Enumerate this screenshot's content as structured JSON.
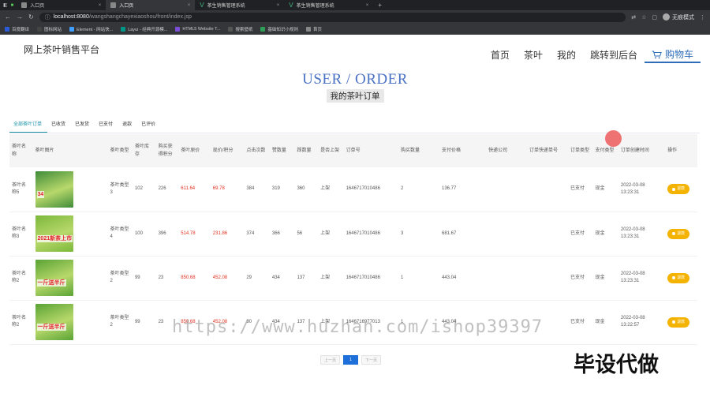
{
  "browser": {
    "tabs": [
      {
        "label": "入口页",
        "active": false,
        "icon": "page-icon"
      },
      {
        "label": "入口页",
        "active": true,
        "icon": "page-icon"
      },
      {
        "label": "茶生销售管理系统",
        "active": false,
        "icon": "vue-icon"
      },
      {
        "label": "茶生销售管理系统",
        "active": false,
        "icon": "vue-icon"
      }
    ],
    "url_host": "localhost:8080",
    "url_path": "/wangshangchayexiaoshou/front/index.jsp",
    "profile_label": "无痕模式",
    "bookmarks": [
      {
        "label": "百度翻译",
        "color": "#2b5bd7"
      },
      {
        "label": "图标网站",
        "color": "#444444"
      },
      {
        "label": "Element - 网站快...",
        "color": "#409eff"
      },
      {
        "label": "Layui - 经典开源模...",
        "color": "#009688"
      },
      {
        "label": "HTML5 Website T...",
        "color": "#7a4fd6"
      },
      {
        "label": "搜索壁纸",
        "color": "#555555"
      },
      {
        "label": "基础知识小规则",
        "color": "#2e9e57"
      },
      {
        "label": "首页",
        "color": "#888888"
      }
    ]
  },
  "header": {
    "brand": "网上茶叶销售平台",
    "nav": [
      "首页",
      "茶叶",
      "我的",
      "跳转到后台",
      "购物车"
    ],
    "title": "USER / ORDER",
    "subtitle": "我的茶叶订单"
  },
  "status_tabs": [
    "全部茶叶订单",
    "已收货",
    "已发货",
    "已支付",
    "退款",
    "已评价"
  ],
  "table": {
    "columns": [
      "茶叶名称",
      "茶叶图片",
      "茶叶类型",
      "茶叶库存",
      "购买获得积分",
      "茶叶原价",
      "现价/积分",
      "点击次数",
      "赞数量",
      "踩数量",
      "是否上架",
      "订单号",
      "购买数量",
      "支付价格",
      "快递公司",
      "订单快递单号",
      "订单类型",
      "支付类型",
      "订单创建时间",
      "操作"
    ],
    "rows": [
      {
        "name": "茶叶名称5",
        "img_color": "#3f8c3a",
        "img_text": "34",
        "type": "茶叶类型3",
        "stock": "102",
        "points": "226",
        "orig": "611.64",
        "price": "69.78",
        "clicks": "384",
        "likes": "319",
        "dislikes": "360",
        "listed": "上架",
        "order_no": "1646717010486",
        "qty": "2",
        "paid": "136.77",
        "courier": "",
        "tracking": "",
        "order_type": "已支付",
        "pay_type": "现金",
        "created": "2022-03-08 13:23:31",
        "action": "退款"
      },
      {
        "name": "茶叶名称3",
        "img_color": "#7bb83b",
        "img_text": "2021新茶上市",
        "type": "茶叶类型4",
        "stock": "100",
        "points": "396",
        "orig": "514.78",
        "price": "231.86",
        "clicks": "374",
        "likes": "366",
        "dislikes": "56",
        "listed": "上架",
        "order_no": "1646717010486",
        "qty": "3",
        "paid": "681.67",
        "courier": "",
        "tracking": "",
        "order_type": "已支付",
        "pay_type": "现金",
        "created": "2022-03-08 13:23:31",
        "action": "退款"
      },
      {
        "name": "茶叶名称2",
        "img_color": "#5aa335",
        "img_text": "一斤送半斤",
        "type": "茶叶类型2",
        "stock": "99",
        "points": "23",
        "orig": "850.68",
        "price": "452.08",
        "clicks": "29",
        "likes": "434",
        "dislikes": "137",
        "listed": "上架",
        "order_no": "1646717010486",
        "qty": "1",
        "paid": "443.04",
        "courier": "",
        "tracking": "",
        "order_type": "已支付",
        "pay_type": "现金",
        "created": "2022-03-08 13:23:31",
        "action": "退款"
      },
      {
        "name": "茶叶名称2",
        "img_color": "#5aa335",
        "img_text": "一斤送半斤",
        "type": "茶叶类型2",
        "stock": "99",
        "points": "23",
        "orig": "850.68",
        "price": "452.08",
        "clicks": "30",
        "likes": "434",
        "dislikes": "137",
        "listed": "上架",
        "order_no": "1646716977013",
        "qty": "1",
        "paid": "443.04",
        "courier": "",
        "tracking": "",
        "order_type": "已支付",
        "pay_type": "现金",
        "created": "2022-03-08 13:22:57",
        "action": "退款"
      }
    ]
  },
  "pager": {
    "prev": "上一页",
    "current": "1",
    "next": "下一页"
  },
  "watermark": {
    "url": "https://www.huzhan.com/ishop39397",
    "text": "毕设代做"
  }
}
